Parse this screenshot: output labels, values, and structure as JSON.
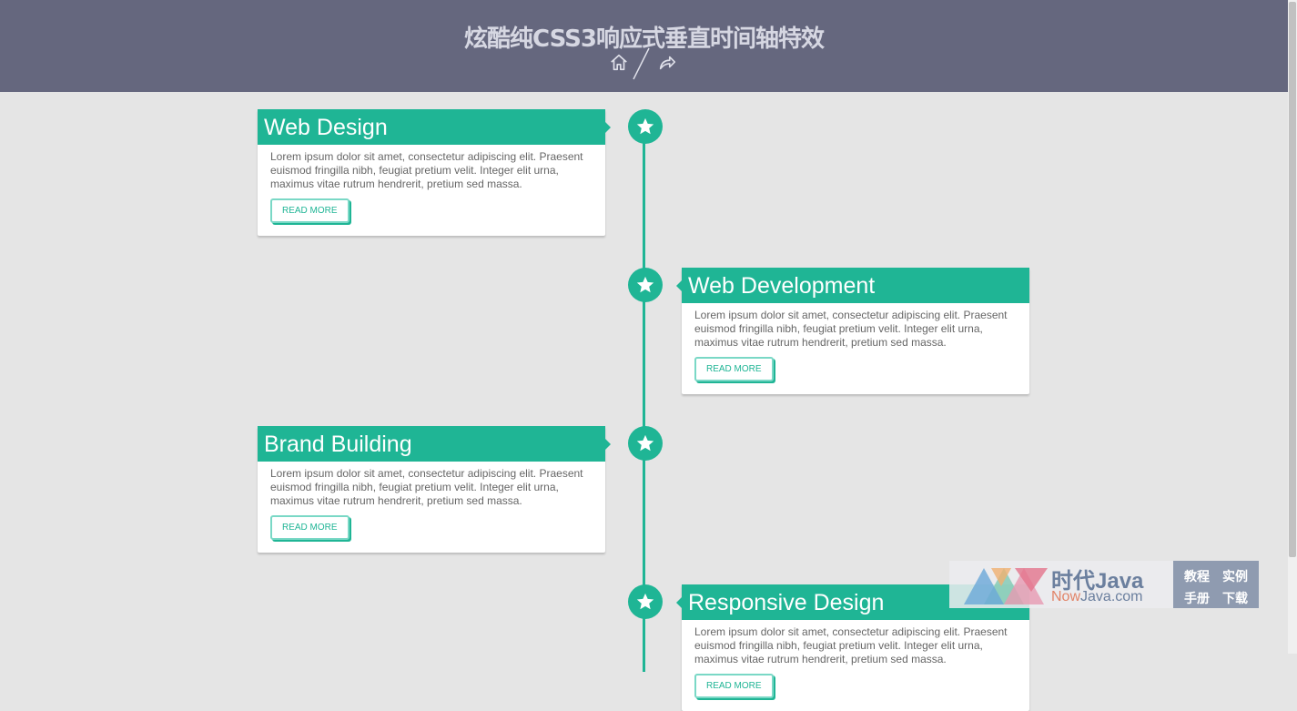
{
  "header": {
    "title": "炫酷纯CSS3响应式垂直时间轴特效",
    "icons": [
      "home-icon",
      "share-icon"
    ]
  },
  "timeline": [
    {
      "title": "Web Design",
      "text": "Lorem ipsum dolor sit amet, consectetur adipiscing elit. Praesent euismod fringilla nibh, feugiat pretium velit. Integer elit urna, maximus vitae rutrum hendrerit, pretium sed massa.",
      "button": "READ MORE",
      "side": "left"
    },
    {
      "title": "Web Development",
      "text": "Lorem ipsum dolor sit amet, consectetur adipiscing elit. Praesent euismod fringilla nibh, feugiat pretium velit. Integer elit urna, maximus vitae rutrum hendrerit, pretium sed massa.",
      "button": "READ MORE",
      "side": "right"
    },
    {
      "title": "Brand Building",
      "text": "Lorem ipsum dolor sit amet, consectetur adipiscing elit. Praesent euismod fringilla nibh, feugiat pretium velit. Integer elit urna, maximus vitae rutrum hendrerit, pretium sed massa.",
      "button": "READ MORE",
      "side": "left"
    },
    {
      "title": "Responsive Design",
      "text": "Lorem ipsum dolor sit amet, consectetur adipiscing elit. Praesent euismod fringilla nibh, feugiat pretium velit. Integer elit urna, maximus vitae rutrum hendrerit, pretium sed massa.",
      "button": "READ MORE",
      "side": "right"
    }
  ],
  "watermark": {
    "brand": "时代Java",
    "domain_now": "Now",
    "domain_rest": "Java.com",
    "menu": [
      "教程",
      "实例",
      "手册",
      "下载"
    ]
  },
  "colors": {
    "accent": "#1fb595",
    "header": "#65677e",
    "background": "#e5e5e5"
  }
}
